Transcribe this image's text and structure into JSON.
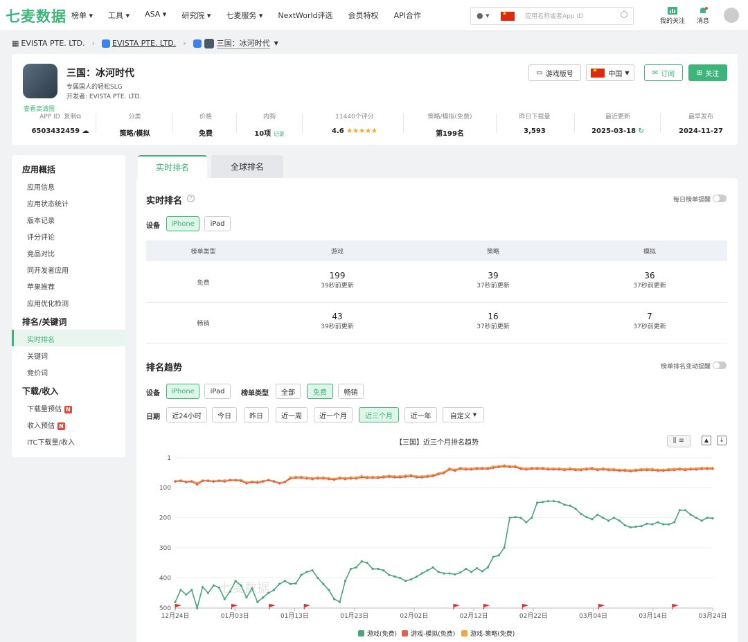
{
  "header": {
    "logo": "七麦数据",
    "nav": [
      "榜单",
      "工具",
      "ASA",
      "研究院",
      "七麦服务",
      "NextWorld评选",
      "会员特权",
      "API合作"
    ],
    "search_placeholder": "应用名称或者App ID",
    "follow": "我的关注",
    "messages": "消息"
  },
  "breadcrumb": [
    "EVISTA PTE. LTD.",
    "EVISTA PTE. LTD.",
    "三国：冰河时代"
  ],
  "app": {
    "name": "三国：冰河时代",
    "subtitle": "专属国人的轻松SLG",
    "developer": "开发者: EVISTA PTE. LTD.",
    "hd_link": "查看高清图",
    "version_btn": "游戏版号",
    "country": "中国",
    "subscribe": "订阅",
    "follow": "关注"
  },
  "stats": [
    {
      "label": "APP ID",
      "label2": "复制",
      "value": "6503432459"
    },
    {
      "label": "分类",
      "value": "策略/模拟"
    },
    {
      "label": "价格",
      "value": "免费"
    },
    {
      "label": "内购",
      "value": "10项",
      "extra": "记录"
    },
    {
      "label": "11440个评分",
      "value": "4.6",
      "stars": "★★★★★"
    },
    {
      "label": "策略/模拟(免费)",
      "value": "第199名"
    },
    {
      "label": "昨日下载量",
      "value": "3,593"
    },
    {
      "label": "最近更新",
      "value": "2025-03-18"
    },
    {
      "label": "最早发布",
      "value": "2024-11-27"
    }
  ],
  "sidebar": {
    "groups": [
      {
        "title": "应用概括",
        "items": [
          "应用信息",
          "应用状态统计",
          "版本记录",
          "评分评论",
          "竞品对比",
          "同开发者应用",
          "苹果推荐",
          "应用优化检测"
        ]
      },
      {
        "title": "排名/关键词",
        "items": [
          "实时排名",
          "关键词",
          "竞价词"
        ]
      },
      {
        "title": "下载/收入",
        "items": [
          "下载量预估",
          "收入预估",
          "ITC下载量/收入"
        ]
      }
    ],
    "active": "实时排名"
  },
  "tabs": [
    "实时排名",
    "全球排名"
  ],
  "realtime": {
    "title": "实时排名",
    "daily_alert": "每日榜单提醒",
    "device_label": "设备",
    "devices": [
      "iPhone",
      "iPad"
    ],
    "headers": [
      "榜单类型",
      "游戏",
      "策略",
      "模拟"
    ],
    "rows": [
      {
        "type": "免费",
        "cells": [
          {
            "v": "199",
            "t": "39秒前更新"
          },
          {
            "v": "39",
            "t": "37秒前更新"
          },
          {
            "v": "36",
            "t": "37秒前更新"
          }
        ]
      },
      {
        "type": "畅销",
        "cells": [
          {
            "v": "43",
            "t": "39秒前更新"
          },
          {
            "v": "16",
            "t": "37秒前更新"
          },
          {
            "v": "7",
            "t": "37秒前更新"
          }
        ]
      }
    ]
  },
  "trend": {
    "title": "排名趋势",
    "alert": "榜单排名变动提醒",
    "device_label": "设备",
    "devices": [
      "iPhone",
      "iPad"
    ],
    "type_label": "榜单类型",
    "types": [
      "全部",
      "免费",
      "畅销"
    ],
    "date_label": "日期",
    "dates": [
      "近24小时",
      "今日",
      "昨日",
      "近一周",
      "近一个月",
      "近三个月",
      "近一年",
      "自定义"
    ],
    "watermark": "七麦数据"
  },
  "chart_data": {
    "type": "line",
    "title": "【三国】近三个月排名趋势",
    "x_ticks": [
      "12月24日",
      "01月03日",
      "01月13日",
      "01月23日",
      "02月02日",
      "02月12日",
      "02月22日",
      "03月04日",
      "03月14日",
      "03月24日"
    ],
    "y_ticks": [
      "1",
      "100",
      "200",
      "300",
      "400",
      "500"
    ],
    "ylim": [
      1,
      500
    ],
    "y_inverted": true,
    "legend_position": "bottom",
    "series": [
      {
        "name": "游戏(免费)",
        "color": "#4aa57a",
        "values": [
          480,
          440,
          455,
          440,
          500,
          430,
          450,
          425,
          432,
          470,
          445,
          410,
          425,
          465,
          435,
          480,
          465,
          450,
          440,
          420,
          410,
          420,
          418,
          390,
          380,
          375,
          400,
          420,
          440,
          470,
          480,
          410,
          370,
          365,
          345,
          350,
          370,
          370,
          375,
          390,
          395,
          400,
          410,
          405,
          396,
          385,
          375,
          365,
          380,
          385,
          385,
          388,
          382,
          370,
          380,
          368,
          378,
          365,
          330,
          325,
          300,
          200,
          198,
          200,
          215,
          200,
          150,
          148,
          145,
          145,
          148,
          157,
          160,
          170,
          188,
          198,
          205,
          190,
          200,
          210,
          200,
          210,
          225,
          232,
          230,
          228,
          220,
          222,
          215,
          222,
          222,
          215,
          175,
          175,
          190,
          200,
          210,
          200,
          202
        ]
      },
      {
        "name": "游戏-模拟(免费)",
        "color": "#e06050",
        "values": [
          80,
          78,
          82,
          80,
          90,
          78,
          78,
          80,
          78,
          80,
          76,
          76,
          78,
          86,
          82,
          84,
          80,
          76,
          80,
          86,
          82,
          70,
          68,
          68,
          70,
          72,
          70,
          70,
          72,
          74,
          70,
          72,
          70,
          70,
          66,
          68,
          68,
          68,
          66,
          64,
          66,
          66,
          64,
          62,
          66,
          66,
          64,
          62,
          56,
          52,
          40,
          44,
          38,
          40,
          40,
          38,
          38,
          38,
          34,
          32,
          30,
          32,
          32,
          38,
          40,
          38,
          38,
          38,
          40,
          40,
          40,
          42,
          40,
          42,
          42,
          40,
          38,
          42,
          40,
          42,
          42,
          44,
          44,
          46,
          44,
          42,
          42,
          42,
          44,
          44,
          42,
          42,
          40,
          42,
          40,
          40,
          38,
          38,
          38
        ]
      },
      {
        "name": "游戏-策略(免费)",
        "color": "#eba843",
        "values": [
          78,
          76,
          80,
          78,
          84,
          76,
          76,
          78,
          76,
          76,
          74,
          74,
          74,
          82,
          80,
          80,
          78,
          74,
          78,
          84,
          80,
          66,
          64,
          64,
          66,
          68,
          66,
          66,
          68,
          70,
          66,
          68,
          66,
          66,
          62,
          64,
          64,
          64,
          62,
          60,
          62,
          62,
          60,
          58,
          62,
          62,
          60,
          58,
          52,
          48,
          36,
          40,
          34,
          36,
          36,
          34,
          34,
          34,
          30,
          28,
          26,
          28,
          28,
          34,
          36,
          34,
          34,
          34,
          36,
          36,
          36,
          38,
          36,
          38,
          38,
          36,
          34,
          38,
          36,
          38,
          38,
          40,
          40,
          42,
          40,
          38,
          38,
          38,
          40,
          40,
          38,
          38,
          36,
          38,
          36,
          36,
          34,
          34,
          34
        ]
      }
    ],
    "flag_positions": [
      0.0,
      0.105,
      0.175,
      0.24,
      0.518,
      0.574,
      0.646,
      0.788,
      0.925
    ]
  }
}
